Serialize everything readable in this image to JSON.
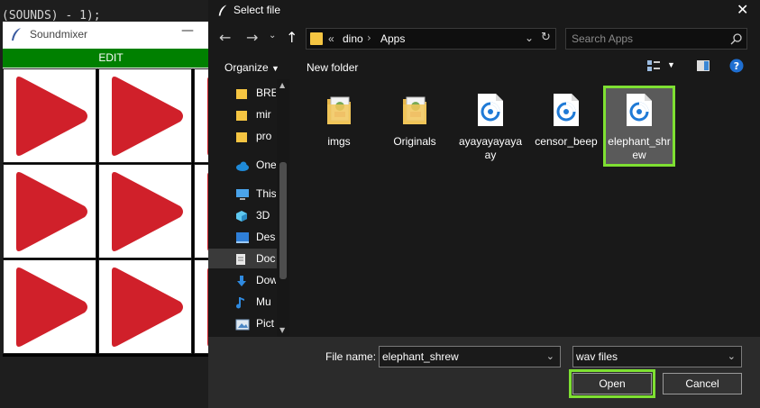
{
  "background_code": "(SOUNDS) - 1);",
  "soundmixer": {
    "title": "Soundmixer",
    "minimize": "—",
    "edit_label": "EDIT",
    "play_color": "#d0202a"
  },
  "dialog": {
    "title": "Select file",
    "close": "✕",
    "path": [
      "«",
      "dino",
      "Apps"
    ],
    "search_placeholder": "Search Apps",
    "organize_label": "Organize",
    "new_folder_label": "New folder",
    "sidebar": [
      {
        "label": "BRE",
        "icon": "folder-icon"
      },
      {
        "label": "mir",
        "icon": "folder-icon"
      },
      {
        "label": "pro",
        "icon": "folder-icon"
      },
      {
        "label": "OneD",
        "icon": "cloud-icon"
      },
      {
        "label": "This",
        "icon": "computer-icon"
      },
      {
        "label": "3D",
        "icon": "cube-icon"
      },
      {
        "label": "Des",
        "icon": "desktop-icon"
      },
      {
        "label": "Doc",
        "icon": "document-icon"
      },
      {
        "label": "Dow",
        "icon": "download-icon"
      },
      {
        "label": "Mu",
        "icon": "music-icon"
      },
      {
        "label": "Pict",
        "icon": "picture-icon"
      }
    ],
    "files": [
      {
        "name": "imgs",
        "type": "folder"
      },
      {
        "name": "Originals",
        "type": "folder"
      },
      {
        "name": "ayayayayayaay",
        "type": "audio"
      },
      {
        "name": "censor_beep",
        "type": "audio"
      },
      {
        "name": "elephant_shrew",
        "type": "audio",
        "selected": true
      }
    ],
    "file_name_label": "File name:",
    "file_name_value": "elephant_shrew",
    "file_type_value": "wav files",
    "open_label": "Open",
    "cancel_label": "Cancel",
    "highlight_color": "#7ee032"
  }
}
